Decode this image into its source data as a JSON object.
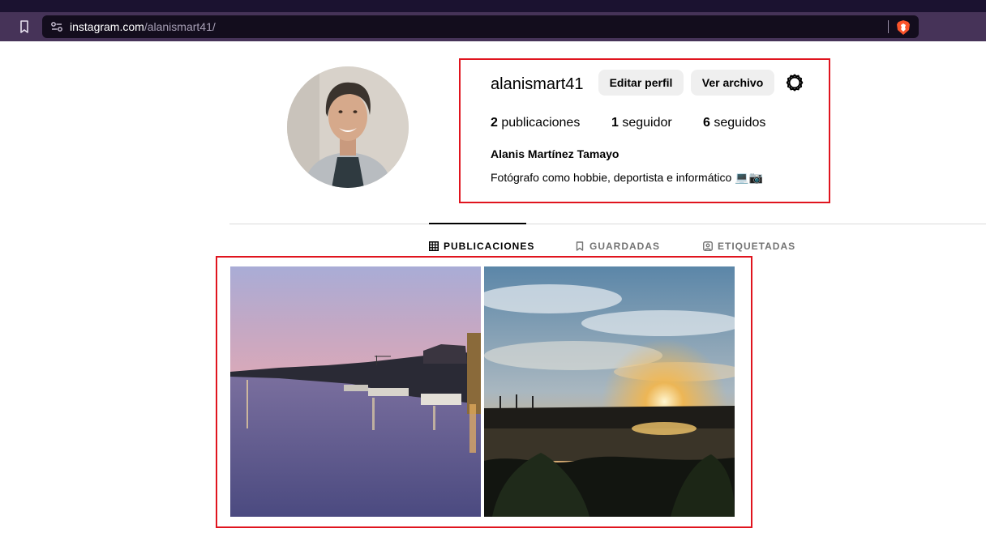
{
  "browser": {
    "url_host": "instagram.com",
    "url_path": "/alanismart41/",
    "icons": {
      "bookmark": "bookmark-icon",
      "site_info": "site-settings-icon",
      "shields": "brave-shield-icon"
    }
  },
  "profile": {
    "username": "alanismart41",
    "edit_profile_label": "Editar perfil",
    "view_archive_label": "Ver archivo",
    "settings_icon": "gear-icon",
    "posts_count": "2",
    "posts_label": "publicaciones",
    "followers_count": "1",
    "followers_label": "seguidor",
    "following_count": "6",
    "following_label": "seguidos",
    "full_name": "Alanis Martínez Tamayo",
    "bio": "Fotógrafo como hobbie, deportista e informático 💻📷"
  },
  "tabs": [
    {
      "label": "PUBLICACIONES",
      "icon": "grid-icon",
      "active": true
    },
    {
      "label": "GUARDADAS",
      "icon": "bookmark-icon",
      "active": false
    },
    {
      "label": "ETIQUETADAS",
      "icon": "tagged-icon",
      "active": false
    }
  ],
  "posts": [
    {
      "description": "river-at-dusk-photo"
    },
    {
      "description": "sunset-over-river-photo"
    }
  ],
  "colors": {
    "annotation_red": "#e0141e",
    "toolbar": "#463358",
    "tabstrip": "#1b1230",
    "button_bg": "#efefef"
  }
}
